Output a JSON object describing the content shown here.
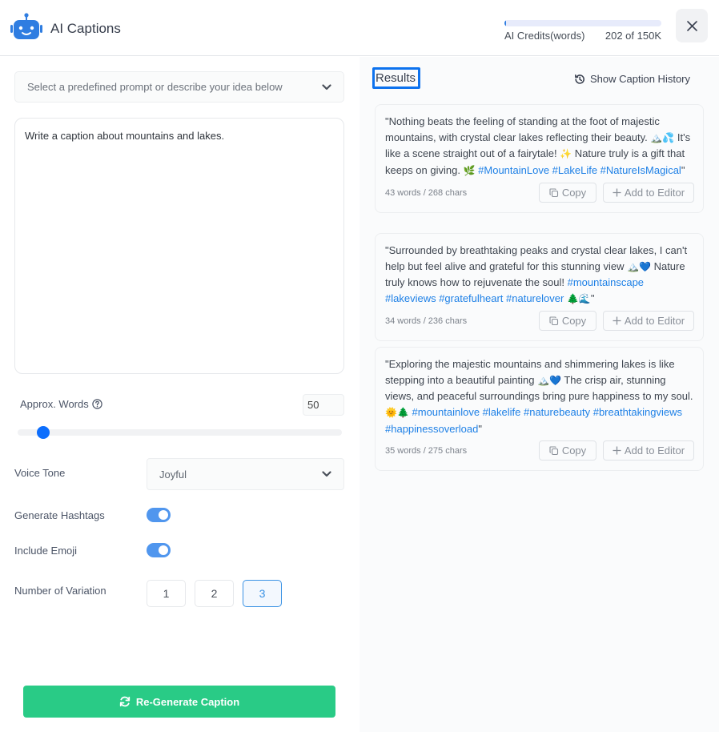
{
  "header": {
    "title": "AI Captions",
    "credits_label": "AI Credits(words)",
    "credits_value": "202 of 150K",
    "credits_used_fraction": 0.00135,
    "close_icon": "close-icon"
  },
  "left": {
    "prompt_select_placeholder": "Select a predefined prompt or describe your idea below",
    "prompt_text": "Write a caption about mountains and lakes.",
    "approx_words_label": "Approx. Words",
    "approx_words_value": "50",
    "slider_fraction": 0.08,
    "voice_tone_label": "Voice Tone",
    "voice_tone_value": "Joyful",
    "generate_hashtags_label": "Generate Hashtags",
    "generate_hashtags_on": true,
    "include_emoji_label": "Include Emoji",
    "include_emoji_on": true,
    "variation_label": "Number of Variation",
    "variations": [
      "1",
      "2",
      "3"
    ],
    "variation_selected": "3",
    "regenerate_label": "Re-Generate Caption"
  },
  "right": {
    "results_title": "Results",
    "history_label": "Show Caption History",
    "copy_label": "Copy",
    "add_label": "Add to Editor",
    "captions": [
      {
        "parts": [
          {
            "t": "\"Nothing beats the feeling of standing at the foot of majestic mountains, with crystal clear lakes reflecting their beauty. "
          },
          {
            "e": "🏔️💦"
          },
          {
            "t": " It's like a scene straight out of a fairytale! "
          },
          {
            "e": "✨"
          },
          {
            "t": " Nature truly is a gift that keeps on giving. "
          },
          {
            "e": "🌿"
          },
          {
            "t": " "
          },
          {
            "h": "#MountainLove #LakeLife #NatureIsMagical"
          },
          {
            "t": "\""
          }
        ],
        "meta": "43 words / 268 chars"
      },
      {
        "parts": [
          {
            "t": "\"Surrounded by breathtaking peaks and crystal clear lakes, I can't help but feel alive and grateful for this stunning view "
          },
          {
            "e": "🏔️💙"
          },
          {
            "t": " Nature truly knows how to rejuvenate the soul! "
          },
          {
            "h": "#mountainscape #lakeviews #gratefulheart #naturelover"
          },
          {
            "t": " "
          },
          {
            "e": "🌲🌊"
          },
          {
            "t": "\""
          }
        ],
        "meta": "34 words / 236 chars"
      },
      {
        "parts": [
          {
            "t": "\"Exploring the majestic mountains and shimmering lakes is like stepping into a beautiful painting "
          },
          {
            "e": "🏔️💙"
          },
          {
            "t": " The crisp air, stunning views, and peaceful surroundings bring pure happiness to my soul. "
          },
          {
            "e": "🌞🌲"
          },
          {
            "t": " "
          },
          {
            "h": "#mountainlove #lakelife #naturebeauty #breathtakingviews #happinessoverload"
          },
          {
            "t": "\""
          }
        ],
        "meta": "35 words / 275 chars"
      }
    ]
  }
}
